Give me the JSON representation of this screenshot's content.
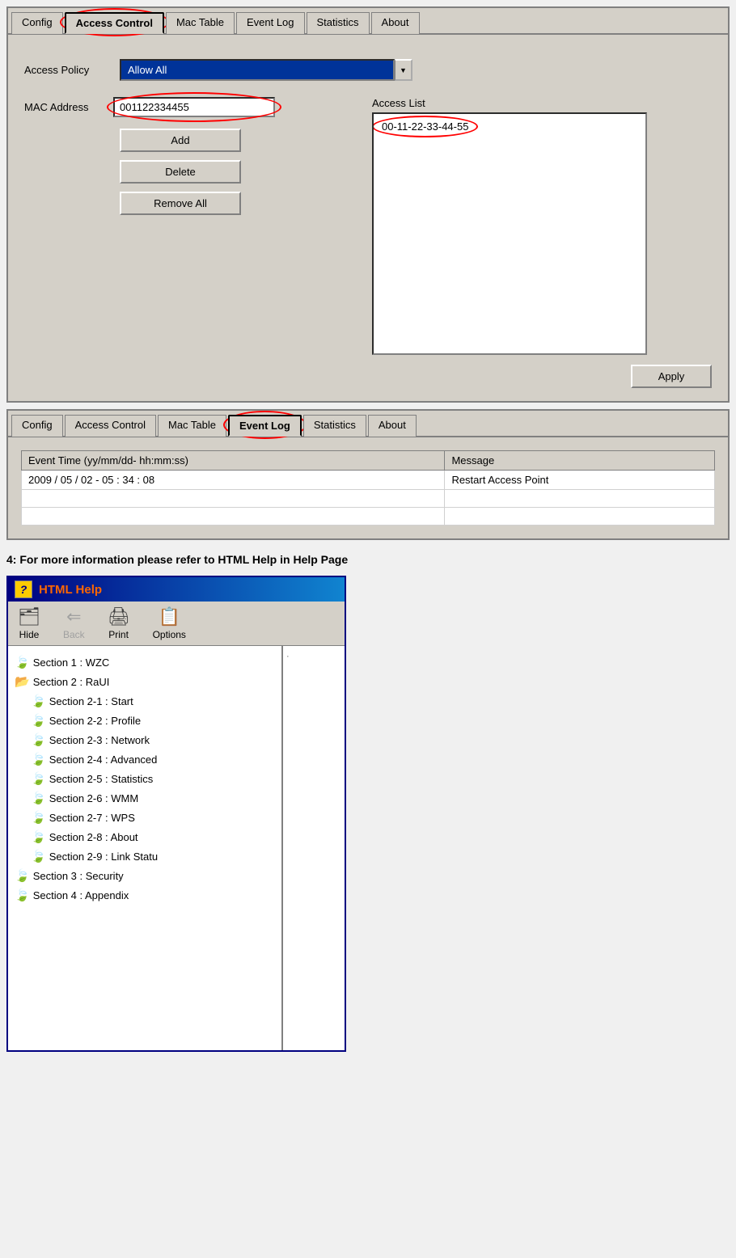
{
  "panel1": {
    "tabs": [
      {
        "label": "Config",
        "active": false,
        "circled": false
      },
      {
        "label": "Access Control",
        "active": true,
        "circled": true
      },
      {
        "label": "Mac Table",
        "active": false,
        "circled": false
      },
      {
        "label": "Event Log",
        "active": false,
        "circled": false
      },
      {
        "label": "Statistics",
        "active": false,
        "circled": false
      },
      {
        "label": "About",
        "active": false,
        "circled": false
      }
    ],
    "access_policy_label": "Access Policy",
    "access_policy_value": "Allow All",
    "mac_address_label": "MAC Address",
    "mac_address_value": "001122334455",
    "access_list_label": "Access List",
    "access_list_items": [
      "00-11-22-33-44-55"
    ],
    "btn_add": "Add",
    "btn_delete": "Delete",
    "btn_remove_all": "Remove All",
    "btn_apply": "Apply"
  },
  "panel2": {
    "tabs": [
      {
        "label": "Config",
        "active": false,
        "circled": false
      },
      {
        "label": "Access Control",
        "active": false,
        "circled": false
      },
      {
        "label": "Mac Table",
        "active": false,
        "circled": false
      },
      {
        "label": "Event Log",
        "active": true,
        "circled": true
      },
      {
        "label": "Statistics",
        "active": false,
        "circled": false
      },
      {
        "label": "About",
        "active": false,
        "circled": false
      }
    ],
    "table_headers": [
      "Event Time (yy/mm/dd- hh:mm:ss)",
      "Message"
    ],
    "table_rows": [
      {
        "time": "2009 / 05 / 02 - 05 : 34 : 08",
        "message": "Restart Access Point"
      },
      {
        "time": "",
        "message": ""
      },
      {
        "time": "",
        "message": ""
      }
    ]
  },
  "instruction": "4: For more information please refer to HTML Help in Help Page",
  "help_window": {
    "title": "HTML Help",
    "icon": "?",
    "toolbar": [
      {
        "label": "Hide",
        "icon": "🗂",
        "disabled": false
      },
      {
        "label": "Back",
        "icon": "⇐",
        "disabled": true
      },
      {
        "label": "Print",
        "icon": "🖨",
        "disabled": false
      },
      {
        "label": "Options",
        "icon": "📋",
        "disabled": false
      }
    ],
    "tree_items": [
      {
        "label": "Section 1 : WZC",
        "indent": 0,
        "type": "book"
      },
      {
        "label": "Section 2 : RaUI",
        "indent": 0,
        "type": "book_open"
      },
      {
        "label": "Section 2-1 : Start",
        "indent": 1,
        "type": "book"
      },
      {
        "label": "Section 2-2 : Profile",
        "indent": 1,
        "type": "book"
      },
      {
        "label": "Section 2-3 : Network",
        "indent": 1,
        "type": "book"
      },
      {
        "label": "Section 2-4 : Advanced",
        "indent": 1,
        "type": "book"
      },
      {
        "label": "Section 2-5 : Statistics",
        "indent": 1,
        "type": "book"
      },
      {
        "label": "Section 2-6 : WMM",
        "indent": 1,
        "type": "book"
      },
      {
        "label": "Section 2-7 : WPS",
        "indent": 1,
        "type": "book"
      },
      {
        "label": "Section 2-8 : About",
        "indent": 1,
        "type": "book"
      },
      {
        "label": "Section 2-9 : Link Statu",
        "indent": 1,
        "type": "book"
      },
      {
        "label": "Section 3 : Security",
        "indent": 0,
        "type": "book"
      },
      {
        "label": "Section 4 : Appendix",
        "indent": 0,
        "type": "book"
      }
    ]
  }
}
